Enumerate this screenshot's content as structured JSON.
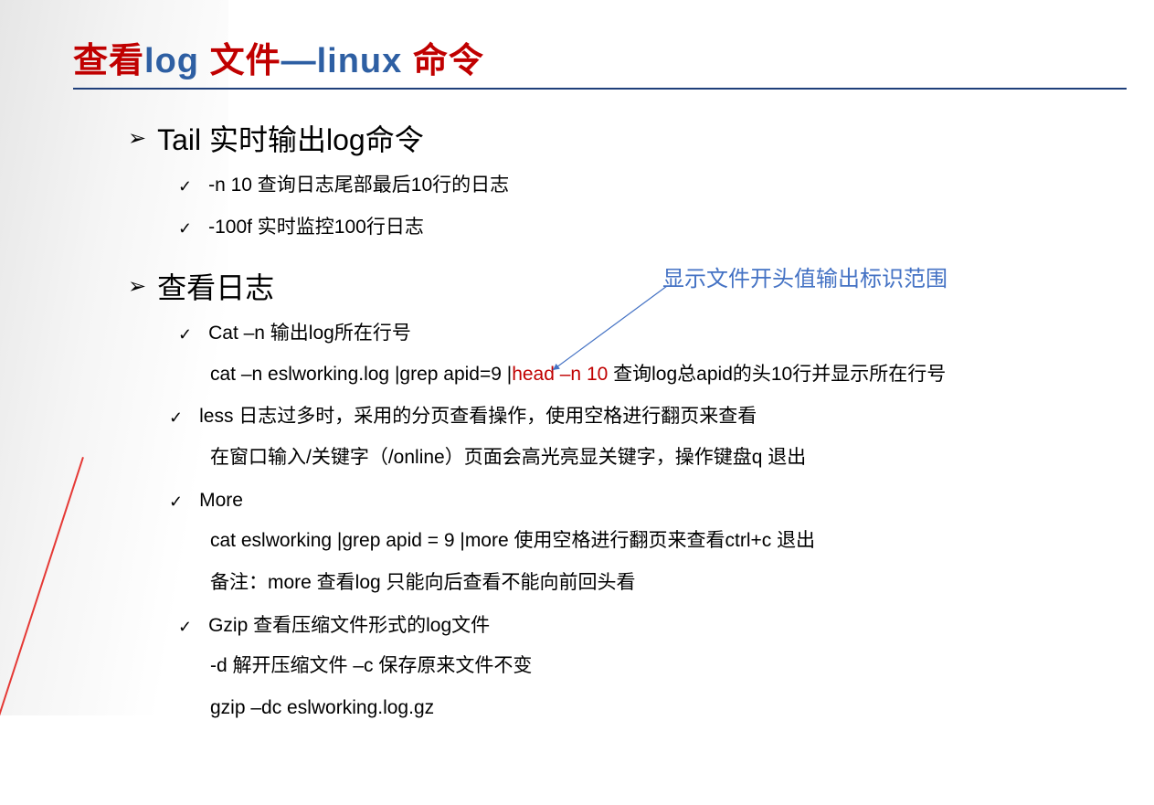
{
  "title": {
    "p1": "查看",
    "p2": "log ",
    "p3": "文件",
    "p4": "—linux ",
    "p5": "命令"
  },
  "annotation": "显示文件开头值输出标识范围",
  "sec1": {
    "heading": "Tail  实时输出log命令",
    "item1": "-n 10   查询日志尾部最后10行的日志",
    "item2": "-100f   实时监控100行日志"
  },
  "sec2": {
    "heading": "查看日志",
    "cat": {
      "label": "Cat –n  输出log所在行号",
      "cmd_pre": "cat –n eslworking.log |grep apid=9 |",
      "cmd_red": "head –n 10",
      "cmd_post": " 查询log总apid的头10行并显示所在行号"
    },
    "less": {
      "label": "less 日志过多时，采用的分页查看操作，使用空格进行翻页来查看",
      "sub": "在窗口输入/关键字（/online）页面会高光亮显关键字，操作键盘q 退出"
    },
    "more": {
      "label": "More",
      "sub1": "cat eslworking |grep apid = 9 |more  使用空格进行翻页来查看ctrl+c 退出",
      "sub2": "备注：more 查看log 只能向后查看不能向前回头看"
    },
    "gzip": {
      "label": "Gzip 查看压缩文件形式的log文件",
      "sub1": "-d 解开压缩文件 –c 保存原来文件不变",
      "sub2": "gzip –dc eslworking.log.gz"
    }
  }
}
